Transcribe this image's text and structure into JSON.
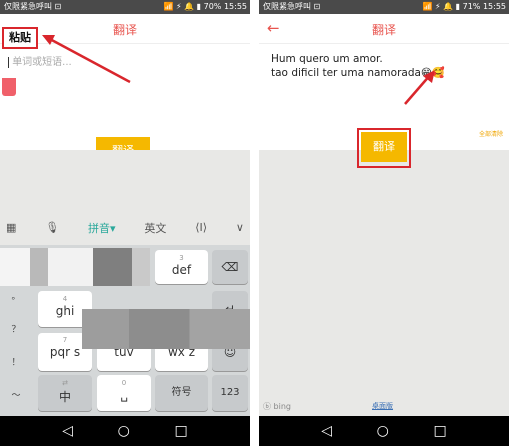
{
  "left": {
    "status": {
      "left": "仅限紧急呼叫 ⊡",
      "right": "📶 ⚡ 🔔 ▮ 70% 15:55"
    },
    "header_title": "翻译",
    "paste_popup": "粘贴",
    "input_placeholder": "单词或短语...",
    "translate_button": "翻译",
    "toolbar": {
      "grid": "▦",
      "mic": "🎙",
      "pinyin": "拼音▾",
      "english": "英文",
      "cursor": "⟨I⟩",
      "collapse": "∨"
    },
    "side_keys": [
      "。",
      "？",
      "！",
      "～"
    ],
    "keys": {
      "def": "def",
      "def_num": "3",
      "ghi": "ghi",
      "ghi_num": "4",
      "pqrs": "pqr s",
      "pqrs_num": "7",
      "tuv": "tuv",
      "tuv_num": "8",
      "wxyz": "wx z",
      "wxyz_num": "9",
      "zh": "中",
      "zh_sub": "⇄",
      "space": "␣",
      "space_num": "0",
      "symbols": "符号",
      "num": "123"
    }
  },
  "right": {
    "status": {
      "left": "仅限紧急呼叫 ⊡",
      "right": "📶 ⚡ 🔔 ▮ 71% 15:55"
    },
    "back_icon": "←",
    "header_title": "翻译",
    "text_lines": [
      "Hum quero um amor.",
      "tao dificil ter uma namorada😁🥰"
    ],
    "clear_link": "全部清除",
    "translate_button": "翻译",
    "bing_logo": "ⓑ bing",
    "footer_link": "桌面版"
  },
  "nav": {
    "back": "◁",
    "home": "○",
    "recent": "□"
  },
  "colors": {
    "accent": "#e8544e",
    "button": "#f5b800",
    "annotation": "#d9262c"
  }
}
